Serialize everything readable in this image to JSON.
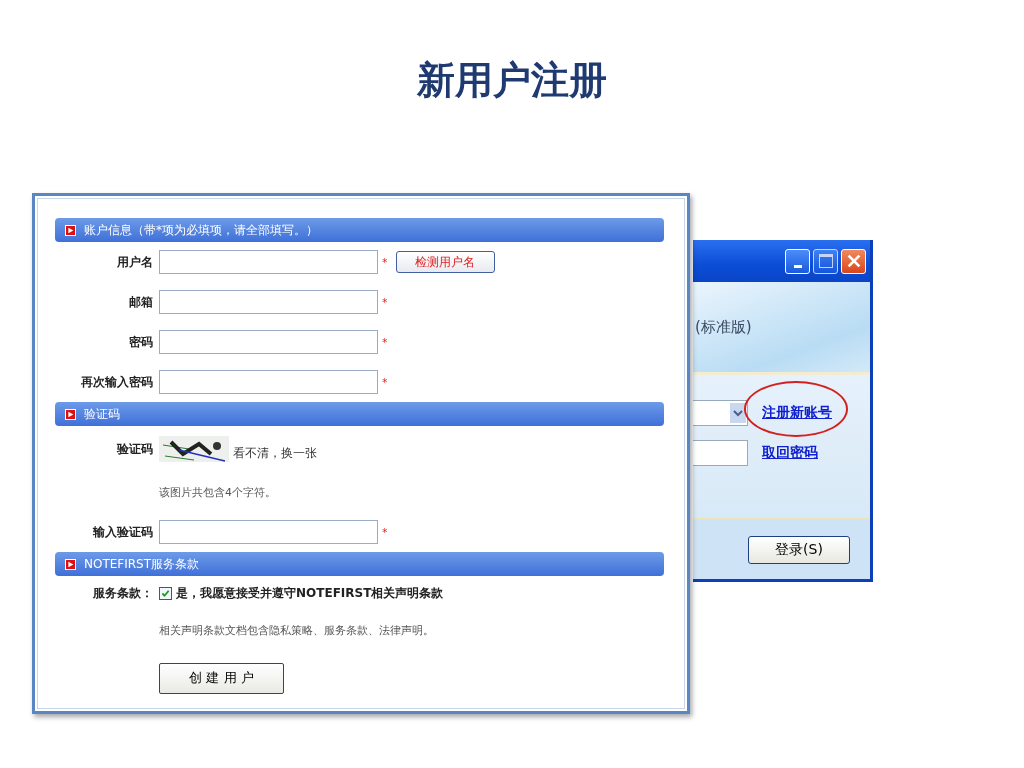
{
  "slide_title": "新用户注册",
  "login_window": {
    "subtitle": "(标准版)",
    "links": [
      "注册新账号",
      "取回密码"
    ],
    "login_button": "登录(S)"
  },
  "form": {
    "sections": [
      {
        "header": "账户信息（带*项为必填项，请全部填写。）",
        "rows": [
          {
            "kind": "field",
            "label": "用户名",
            "required": "*",
            "button": "检测用户名"
          },
          {
            "kind": "field",
            "label": "邮箱",
            "required": "*"
          },
          {
            "kind": "field",
            "label": "密码",
            "required": "*"
          },
          {
            "kind": "field",
            "label": "再次输入密码",
            "required": "*"
          }
        ]
      },
      {
        "header": "验证码",
        "rows": [
          {
            "kind": "captcha",
            "label": "验证码",
            "link": "看不清，换一张"
          },
          {
            "kind": "hint",
            "text": "该图片共包含4个字符。"
          },
          {
            "kind": "field",
            "label": "输入验证码",
            "required": "*"
          }
        ]
      },
      {
        "header": "NOTEFIRST服务条款",
        "rows": [
          {
            "kind": "terms",
            "label": "服务条款：",
            "checked": true,
            "text": "是，我愿意接受并遵守NOTEFIRST相关声明条款"
          },
          {
            "kind": "hint",
            "text": "相关声明条款文档包含隐私策略、服务条款、法律声明。"
          },
          {
            "kind": "submit",
            "button": "创 建 用 户"
          }
        ]
      }
    ]
  }
}
